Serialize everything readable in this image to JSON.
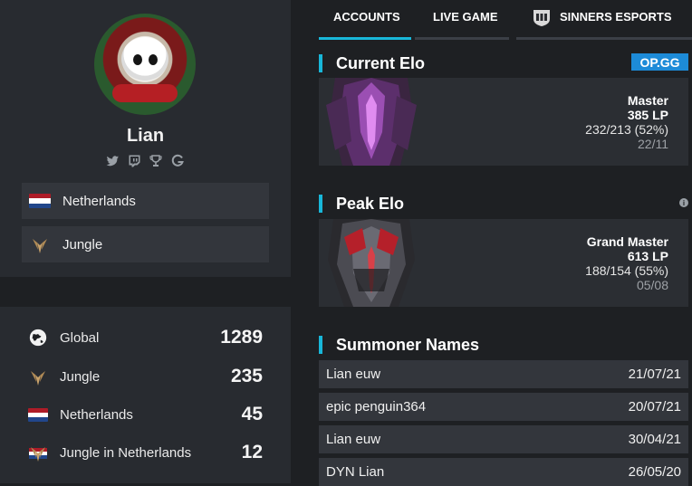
{
  "profile": {
    "name": "Lian",
    "socials": [
      "twitter-icon",
      "twitch-icon",
      "trophy-icon",
      "gamepedia-icon"
    ],
    "country": "Netherlands",
    "role": "Jungle"
  },
  "ranks": [
    {
      "label": "Global",
      "value": "1289",
      "icon": "globe-icon"
    },
    {
      "label": "Jungle",
      "value": "235",
      "icon": "jungle-icon"
    },
    {
      "label": "Netherlands",
      "value": "45",
      "icon": "flag-nl-icon"
    },
    {
      "label": "Jungle in Netherlands",
      "value": "12",
      "icon": "jungle-nl-icon"
    }
  ],
  "tabs": [
    {
      "label": "ACCOUNTS",
      "active": true
    },
    {
      "label": "LIVE GAME",
      "active": false
    },
    {
      "label": "SINNERS ESPORTS",
      "active": false
    }
  ],
  "current_elo": {
    "title": "Current Elo",
    "badge": "OP.GG",
    "tier": "Master",
    "lp": "385 LP",
    "record": "232/213 (52%)",
    "date": "22/11"
  },
  "peak_elo": {
    "title": "Peak Elo",
    "tier": "Grand Master",
    "lp": "613 LP",
    "record": "188/154 (55%)",
    "date": "05/08"
  },
  "summoner_names": {
    "title": "Summoner Names",
    "rows": [
      {
        "name": "Lian euw",
        "date": "21/07/21"
      },
      {
        "name": "epic penguin364",
        "date": "20/07/21"
      },
      {
        "name": "Lian euw",
        "date": "30/04/21"
      },
      {
        "name": "DYN Lian",
        "date": "26/05/20"
      }
    ]
  },
  "colors": {
    "accent": "#18b7d9",
    "opgg": "#1d8bd8",
    "panel": "#282b30"
  }
}
